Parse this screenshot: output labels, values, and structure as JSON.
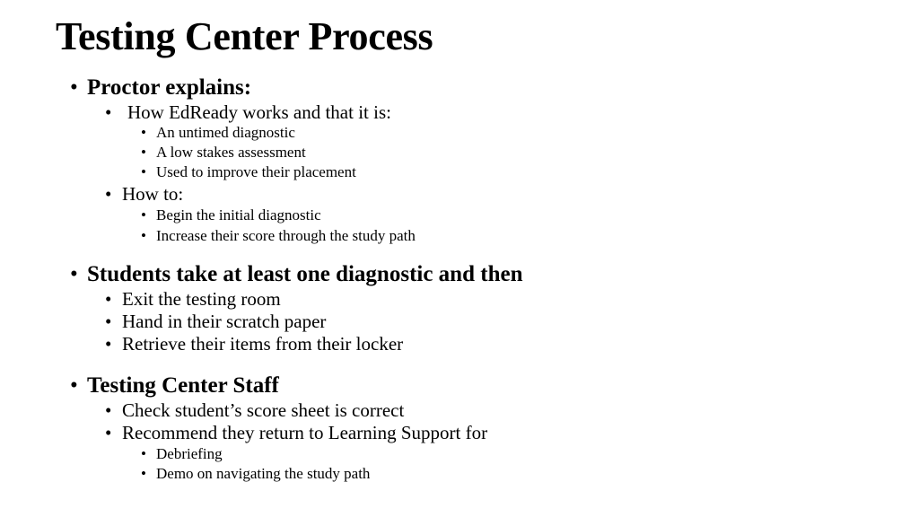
{
  "slide": {
    "title": "Testing Center Process",
    "bullet_glyph": "•",
    "sections": [
      {
        "heading": "Proctor explains:",
        "items": [
          {
            "text": "How EdReady works and that it is:",
            "subitems": [
              "An untimed diagnostic",
              "A low stakes assessment",
              "Used to improve their placement"
            ]
          },
          {
            "text": "How to:",
            "subitems": [
              "Begin the initial diagnostic",
              "Increase their score through the study path"
            ]
          }
        ]
      },
      {
        "heading": "Students take at least one diagnostic and then",
        "items": [
          {
            "text": "Exit the testing room",
            "subitems": []
          },
          {
            "text": "Hand in their scratch paper",
            "subitems": []
          },
          {
            "text": "Retrieve their items from their locker",
            "subitems": []
          }
        ]
      },
      {
        "heading": "Testing Center Staff",
        "items": [
          {
            "text": "Check student’s score sheet is correct",
            "subitems": []
          },
          {
            "text": "Recommend they return to Learning Support for",
            "subitems": [
              "Debriefing",
              "Demo on navigating the study path"
            ]
          }
        ]
      }
    ]
  }
}
